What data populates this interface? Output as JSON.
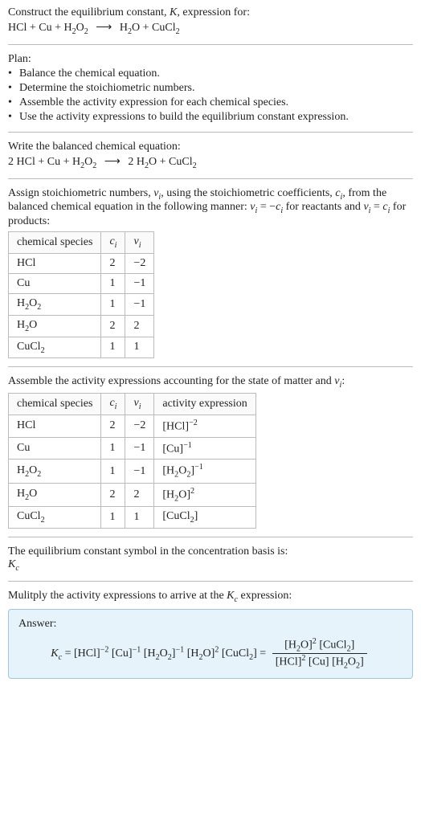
{
  "intro": {
    "line1_pre": "Construct the equilibrium constant, ",
    "K": "K",
    "line1_post": ", expression for:",
    "eq_lhs": "HCl + Cu + H",
    "eq_lhs_sub1": "2",
    "eq_lhs_mid": "O",
    "eq_lhs_sub2": "2",
    "arrow": "⟶",
    "eq_rhs_a": "H",
    "eq_rhs_sub1": "2",
    "eq_rhs_b": "O + CuCl",
    "eq_rhs_sub2": "2"
  },
  "plan": {
    "header": "Plan:",
    "bullets": [
      "Balance the chemical equation.",
      "Determine the stoichiometric numbers.",
      "Assemble the activity expression for each chemical species.",
      "Use the activity expressions to build the equilibrium constant expression."
    ],
    "dot": "•"
  },
  "balanced": {
    "header": "Write the balanced chemical equation:",
    "lhs_a": "2 HCl + Cu + H",
    "lhs_sub1": "2",
    "lhs_b": "O",
    "lhs_sub2": "2",
    "arrow": "⟶",
    "rhs_a": "2 H",
    "rhs_sub1": "2",
    "rhs_b": "O + CuCl",
    "rhs_sub2": "2"
  },
  "assign": {
    "text_a": "Assign stoichiometric numbers, ",
    "nu": "ν",
    "i": "i",
    "text_b": ", using the stoichiometric coefficients, ",
    "c": "c",
    "text_c": ", from the balanced chemical equation in the following manner: ",
    "rel1_l": "ν",
    "rel1_eq": " = −",
    "rel1_r": "c",
    "text_d": " for reactants and ",
    "rel2_eq": " = ",
    "text_e": " for products:"
  },
  "table1": {
    "h1": "chemical species",
    "h2": "c",
    "h2_sub": "i",
    "h3": "ν",
    "h3_sub": "i",
    "rows": [
      {
        "sp_a": "HCl",
        "sp_sub": "",
        "c": "2",
        "nu": "−2"
      },
      {
        "sp_a": "Cu",
        "sp_sub": "",
        "c": "1",
        "nu": "−1"
      },
      {
        "sp_a": "H",
        "sp_sub": "2",
        "sp_b": "O",
        "sp_sub2": "2",
        "c": "1",
        "nu": "−1"
      },
      {
        "sp_a": "H",
        "sp_sub": "2",
        "sp_b": "O",
        "sp_sub2": "",
        "c": "2",
        "nu": "2"
      },
      {
        "sp_a": "CuCl",
        "sp_sub": "2",
        "sp_b": "",
        "sp_sub2": "",
        "c": "1",
        "nu": "1"
      }
    ]
  },
  "assemble_text": {
    "text_a": "Assemble the activity expressions accounting for the state of matter and ",
    "nu": "ν",
    "i": "i",
    "text_b": ":"
  },
  "table2": {
    "h1": "chemical species",
    "h2": "c",
    "h2_sub": "i",
    "h3": "ν",
    "h3_sub": "i",
    "h4": "activity expression",
    "rows": [
      {
        "sp_a": "HCl",
        "sp_sub": "",
        "sp_b": "",
        "sp_sub2": "",
        "c": "2",
        "nu": "−2",
        "act_l": "[HCl]",
        "act_sup": "−2"
      },
      {
        "sp_a": "Cu",
        "sp_sub": "",
        "sp_b": "",
        "sp_sub2": "",
        "c": "1",
        "nu": "−1",
        "act_l": "[Cu]",
        "act_sup": "−1"
      },
      {
        "sp_a": "H",
        "sp_sub": "2",
        "sp_b": "O",
        "sp_sub2": "2",
        "c": "1",
        "nu": "−1",
        "act_l": "[H",
        "act_sub": "2",
        "act_mid": "O",
        "act_sub2": "2",
        "act_r": "]",
        "act_sup": "−1"
      },
      {
        "sp_a": "H",
        "sp_sub": "2",
        "sp_b": "O",
        "sp_sub2": "",
        "c": "2",
        "nu": "2",
        "act_l": "[H",
        "act_sub": "2",
        "act_mid": "O]",
        "act_sup": "2"
      },
      {
        "sp_a": "CuCl",
        "sp_sub": "2",
        "sp_b": "",
        "sp_sub2": "",
        "c": "1",
        "nu": "1",
        "act_l": "[CuCl",
        "act_sub": "2",
        "act_mid": "]"
      }
    ]
  },
  "kc_symbol": {
    "text": "The equilibrium constant symbol in the concentration basis is:",
    "K": "K",
    "c": "c"
  },
  "multiply": {
    "text_a": "Mulitply the activity expressions to arrive at the ",
    "K": "K",
    "c": "c",
    "text_b": " expression:"
  },
  "answer": {
    "title": "Answer:",
    "K": "K",
    "c": "c",
    "eq": " = ",
    "t1": "[HCl]",
    "e1": "−2",
    "t2": " [Cu]",
    "e2": "−1",
    "t3": " [H",
    "s3a": "2",
    "t3b": "O",
    "s3b": "2",
    "t3c": "]",
    "e3": "−1",
    "t4": " [H",
    "s4": "2",
    "t4b": "O]",
    "e4": "2",
    "t5": " [CuCl",
    "s5": "2",
    "t5b": "] = ",
    "num_a": "[H",
    "num_s1": "2",
    "num_b": "O]",
    "num_e1": "2",
    "num_c": " [CuCl",
    "num_s2": "2",
    "num_d": "]",
    "den_a": "[HCl]",
    "den_e1": "2",
    "den_b": " [Cu] [H",
    "den_s1": "2",
    "den_c": "O",
    "den_s2": "2",
    "den_d": "]"
  }
}
